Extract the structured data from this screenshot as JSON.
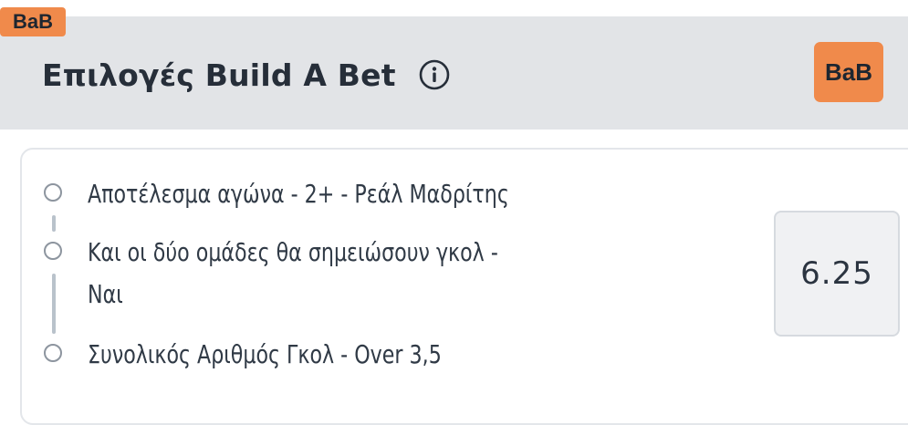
{
  "tag": {
    "label": "BaB"
  },
  "header": {
    "title": "Επιλογές Build A Bet",
    "bab_button_label": "BaB"
  },
  "colors": {
    "accent": "#f08a4b",
    "header_bg": "#e2e4e7",
    "odds_bg": "#f0f1f3"
  },
  "selections": [
    {
      "label": "Αποτέλεσμα αγώνα - 2+ - Ρεάλ Μαδρίτης"
    },
    {
      "label_line1": "Και οι δύο ομάδες θα σημειώσουν γκολ -",
      "label_line2": "Ναι"
    },
    {
      "label": "Συνολικός Αριθμός Γκολ - Over 3,5"
    }
  ],
  "odds": {
    "value": "6.25"
  }
}
